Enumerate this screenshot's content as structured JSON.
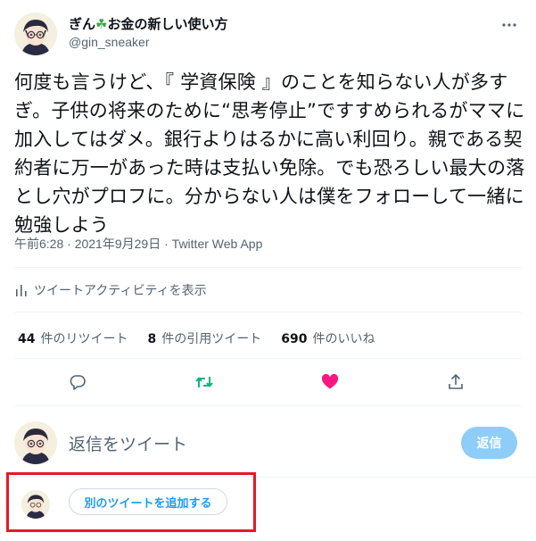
{
  "author": {
    "display_name": "ぎん",
    "clover": "☘",
    "display_name_rest": "お金の新しい使い方",
    "handle": "@gin_sneaker"
  },
  "tweet": {
    "text": "何度も言うけど、『 学資保険 』のことを知らない人が多すぎ。子供の将来のために“思考停止”ですすめられるがママに加入してはダメ。銀行よりはるかに高い利回り。親である契約者に万一があった時は支払い免除。でも恐ろしい最大の落とし穴がプロフに。分からない人は僕をフォローして一緒に勉強しよう",
    "time": "午前6:28",
    "sep": " · ",
    "date": "2021年9月29日",
    "source": "Twitter Web App"
  },
  "activity_label": "ツイートアクティビティを表示",
  "stats": {
    "retweets_count": "44",
    "retweets_label": "件のリツイート",
    "quotes_count": "8",
    "quotes_label": "件の引用ツイート",
    "likes_count": "690",
    "likes_label": "件のいいね"
  },
  "reply": {
    "placeholder": "返信をツイート",
    "button": "返信"
  },
  "add_tweet_label": "別のツイートを追加する",
  "colors": {
    "accent": "#1d9bf0",
    "retweet_active": "#00ba7c",
    "like_active": "#f91880",
    "highlight_box": "#e31b23"
  },
  "icons": [
    "more-icon",
    "bar-chart-icon",
    "reply-icon",
    "retweet-icon",
    "heart-icon",
    "share-icon"
  ]
}
